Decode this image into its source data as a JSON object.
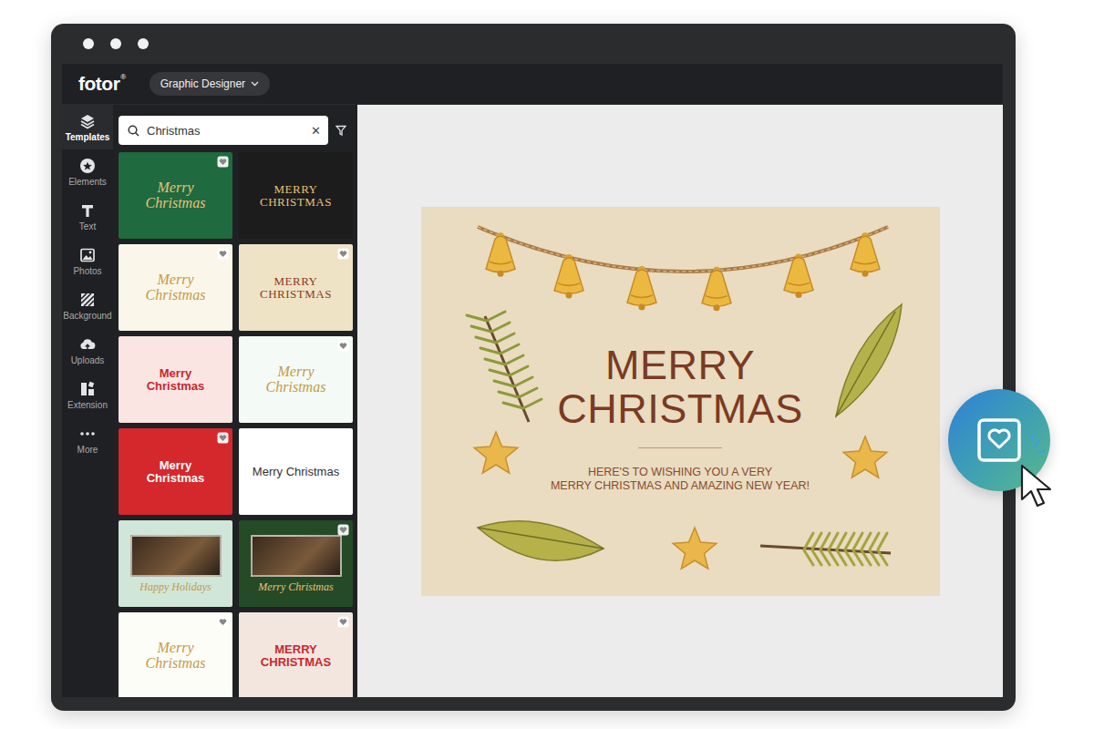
{
  "app": {
    "logo": "fotor",
    "logo_mark": "®",
    "mode_menu": {
      "label": "Graphic Designer"
    }
  },
  "sidebar": {
    "items": [
      {
        "label": "Templates",
        "selected": true
      },
      {
        "label": "Elements",
        "selected": false
      },
      {
        "label": "Text",
        "selected": false
      },
      {
        "label": "Photos",
        "selected": false
      },
      {
        "label": "Background",
        "selected": false
      },
      {
        "label": "Uploads",
        "selected": false
      },
      {
        "label": "Extension",
        "selected": false
      },
      {
        "label": "More",
        "selected": false
      }
    ]
  },
  "search": {
    "value": "Christmas",
    "clear": "✕"
  },
  "templates": [
    {
      "title": "Merry Christmas",
      "kind": "script",
      "color": "#1f6a3e",
      "premium": true,
      "photo": false
    },
    {
      "title": "MERRY CHRISTMAS",
      "kind": "serif",
      "color": "#1c1c1c",
      "premium": false,
      "photo": false
    },
    {
      "title": "Merry Christmas",
      "kind": "script",
      "color": "#fbf6ea",
      "premium": true,
      "photo": false
    },
    {
      "title": "MERRY CHRISTMAS",
      "kind": "serif",
      "color": "#efe3c6",
      "premium": true,
      "photo": false
    },
    {
      "title": "Merry Christmas",
      "kind": "bold",
      "color": "#fbe5e3",
      "premium": false,
      "photo": false
    },
    {
      "title": "Merry Christmas",
      "kind": "script",
      "color": "#f4faf6",
      "premium": true,
      "photo": false
    },
    {
      "title": "Merry Christmas",
      "kind": "bold",
      "color": "#d5282c",
      "premium": true,
      "photo": false
    },
    {
      "title": "Merry Christmas",
      "kind": "sans",
      "color": "#ffffff",
      "premium": false,
      "photo": false
    },
    {
      "title": "Happy Holidays",
      "kind": "script",
      "color": "#cfe6d8",
      "premium": false,
      "photo": true
    },
    {
      "title": "Merry Christmas",
      "kind": "script",
      "color": "#254a26",
      "premium": true,
      "photo": true
    },
    {
      "title": "Merry Christmas",
      "kind": "script",
      "color": "#fdfdf8",
      "premium": true,
      "photo": false
    },
    {
      "title": "MERRY CHRISTMAS",
      "kind": "bold",
      "color": "#f3e6df",
      "premium": true,
      "photo": false
    }
  ],
  "canvas": {
    "card": {
      "title_lines": [
        "MERRY",
        "CHRISTMAS"
      ],
      "message_lines": [
        "HERE'S TO WISHING YOU A VERY",
        "MERRY CHRISTMAS AND AMAZING NEW YEAR!"
      ]
    }
  }
}
